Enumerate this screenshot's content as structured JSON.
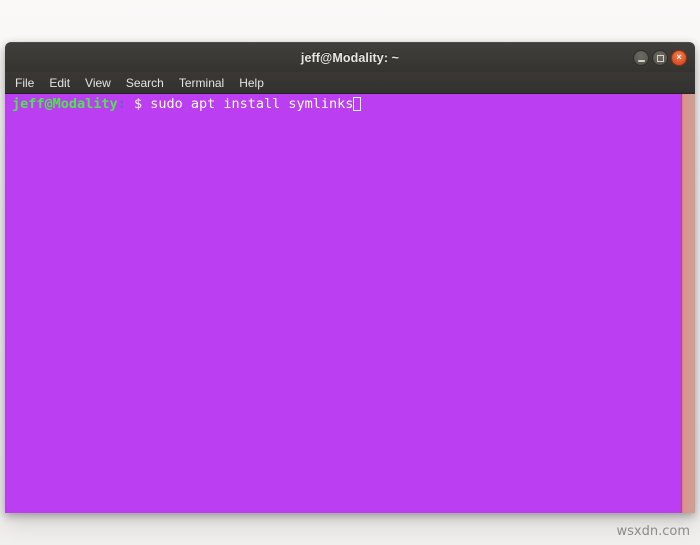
{
  "window": {
    "title": "jeff@Modality: ~",
    "controls": {
      "minimize_label": "–",
      "maximize_label": "□",
      "close_label": "×"
    }
  },
  "menu": {
    "items": [
      {
        "label": "File"
      },
      {
        "label": "Edit"
      },
      {
        "label": "View"
      },
      {
        "label": "Search"
      },
      {
        "label": "Terminal"
      },
      {
        "label": "Help"
      }
    ]
  },
  "terminal": {
    "background_color": "#bb3ef2",
    "foreground_color": "#ffffff",
    "prompt": {
      "user_host": "jeff@Modality",
      "separator": ":",
      "symbol": " $ ",
      "command": "sudo apt install symlinks"
    },
    "prompt_colors": {
      "user_host": "#4ee44e",
      "separator": "#6a5acd",
      "command": "#ffffff"
    },
    "cursor": {
      "style": "hollow-block"
    }
  },
  "watermark": {
    "text": "wsxdn.com"
  }
}
